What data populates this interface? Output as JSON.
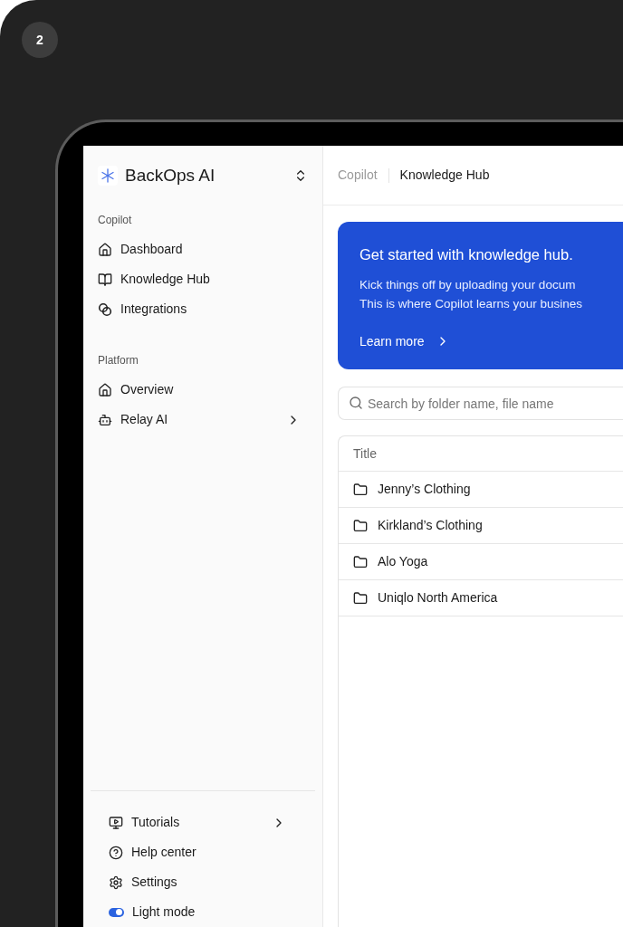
{
  "step_badge": "2",
  "sidebar": {
    "brand": "BackOps AI",
    "sections": [
      {
        "heading": "Copilot",
        "items": [
          {
            "label": "Dashboard",
            "expandable": false
          },
          {
            "label": "Knowledge Hub",
            "expandable": false
          },
          {
            "label": "Integrations",
            "expandable": false
          }
        ]
      },
      {
        "heading": "Platform",
        "items": [
          {
            "label": "Overview",
            "expandable": false
          },
          {
            "label": "Relay AI",
            "expandable": true
          }
        ]
      }
    ],
    "footer_items": [
      {
        "kind": "link",
        "label": "Tutorials",
        "expandable": true
      },
      {
        "kind": "link",
        "label": "Help center",
        "expandable": false
      },
      {
        "kind": "link",
        "label": "Settings",
        "expandable": false
      },
      {
        "kind": "toggle",
        "label": "Light mode",
        "on": true
      }
    ]
  },
  "breadcrumb": [
    "Copilot",
    "Knowledge Hub"
  ],
  "banner": {
    "title": "Get started with knowledge hub.",
    "lines": [
      "Kick things off by uploading your docum",
      "This is where Copilot learns your busines"
    ],
    "link": "Learn more"
  },
  "search": {
    "placeholder": "Search by folder name, file name"
  },
  "table": {
    "columns": [
      "Title"
    ],
    "rows": [
      "Jenny’s Clothing",
      "Kirkland’s Clothing",
      "Alo Yoga",
      "Uniqlo North America"
    ]
  }
}
